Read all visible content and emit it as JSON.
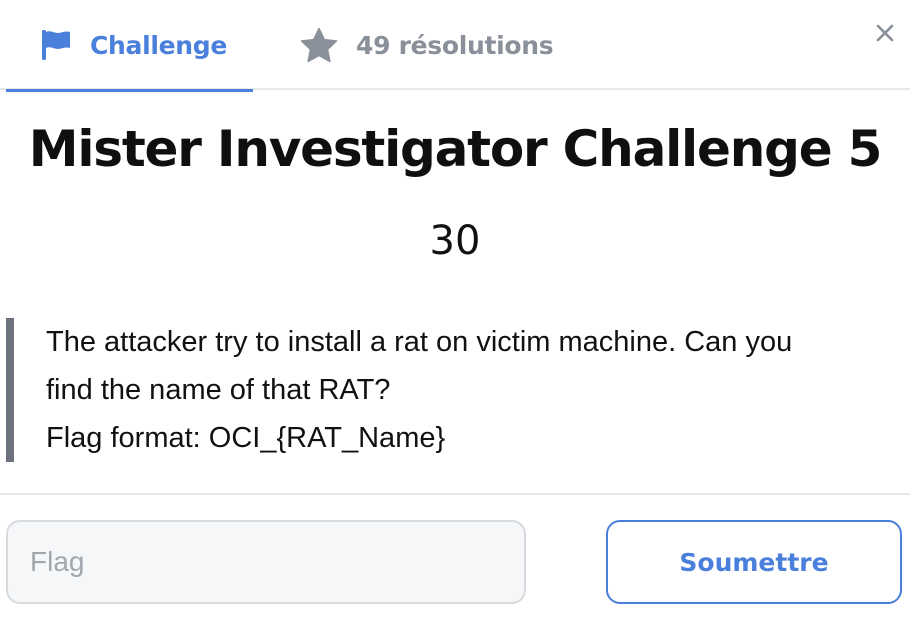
{
  "tabs": {
    "challenge": {
      "label": "Challenge",
      "icon": "flag-icon",
      "active": true
    },
    "solves": {
      "label": "49 résolutions",
      "icon": "star-icon"
    }
  },
  "close": {
    "icon": "close-icon",
    "glyph": "×"
  },
  "challenge": {
    "title": "Mister Investigator Challenge 5",
    "points": "30",
    "description": [
      "The attacker try to install a rat on victim machine. Can you",
      "find the name of that RAT?",
      "Flag format: OCI_{RAT_Name}"
    ]
  },
  "form": {
    "flag_placeholder": "Flag",
    "flag_value": "",
    "submit_label": "Soumettre"
  },
  "colors": {
    "accent": "#4b7fdc",
    "muted": "#8a9099",
    "border": "#d6d9dd",
    "quote_bar": "#6c737f"
  }
}
